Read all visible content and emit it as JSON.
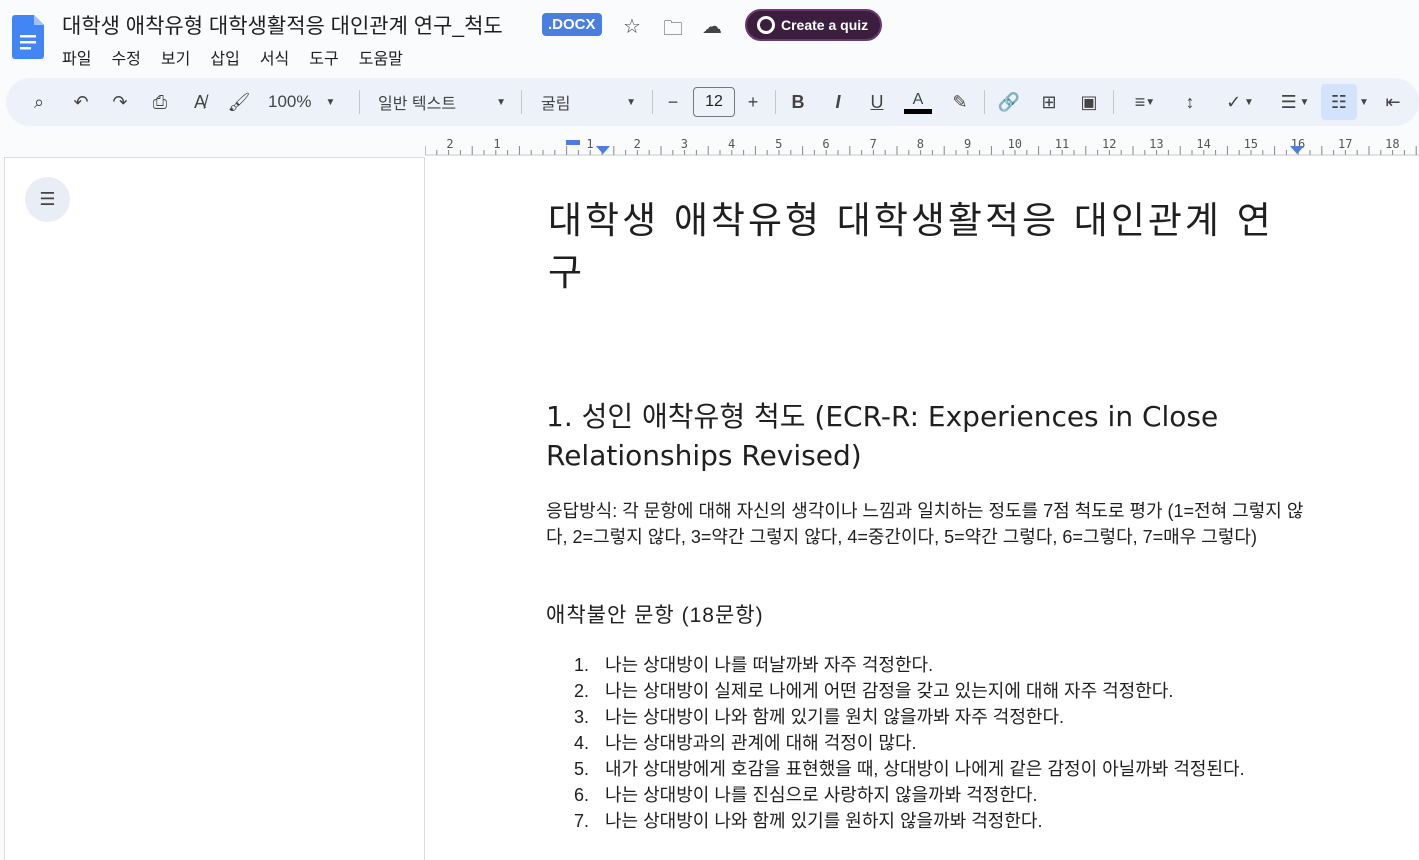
{
  "header": {
    "title": "대학생 애착유형 대학생활적응 대인관계 연구_척도",
    "badge": ".DOCX",
    "quiz_label": "Create a quiz"
  },
  "menu": [
    "파일",
    "수정",
    "보기",
    "삽입",
    "서식",
    "도구",
    "도움말"
  ],
  "toolbar": {
    "zoom": "100%",
    "style": "일반 텍스트",
    "font": "굴림",
    "font_size": "12",
    "text_color": "#000000"
  },
  "ruler": {
    "labels": [
      "2",
      "1",
      "1",
      "2",
      "3",
      "4",
      "5",
      "6",
      "7",
      "8",
      "9",
      "10",
      "11",
      "12",
      "13",
      "14",
      "15",
      "16",
      "17",
      "18"
    ]
  },
  "document": {
    "title": "대학생 애착유형 대학생활적응 대인관계 연구",
    "heading": "1. 성인 애착유형 척도 (ECR-R: Experiences in Close Relationships Revised)",
    "response": "응답방식: 각 문항에 대해 자신의 생각이나 느낌과 일치하는 정도를 7점 척도로 평가 (1=전혀 그렇지 않다, 2=그렇지 않다, 3=약간 그렇지 않다, 4=중간이다, 5=약간 그렇다, 6=그렇다, 7=매우 그렇다)",
    "subheading": "애착불안 문항 (18문항)",
    "items": [
      {
        "n": "1.",
        "text": "나는 상대방이 나를 떠날까봐 자주 걱정한다."
      },
      {
        "n": "2.",
        "text": "나는 상대방이 실제로 나에게 어떤 감정을 갖고 있는지에 대해 자주 걱정한다."
      },
      {
        "n": "3.",
        "text": "나는 상대방이 나와 함께 있기를 원치 않을까봐 자주 걱정한다."
      },
      {
        "n": "4.",
        "text": "나는 상대방과의 관계에 대해 걱정이 많다."
      },
      {
        "n": "5.",
        "text": "내가 상대방에게 호감을 표현했을 때, 상대방이 나에게 같은 감정이 아닐까봐 걱정된다."
      },
      {
        "n": "6.",
        "text": "나는 상대방이 나를 진심으로 사랑하지 않을까봐 걱정한다."
      },
      {
        "n": "7.",
        "text": "나는 상대방이 나와 함께 있기를 원하지 않을까봐 걱정한다."
      }
    ]
  }
}
